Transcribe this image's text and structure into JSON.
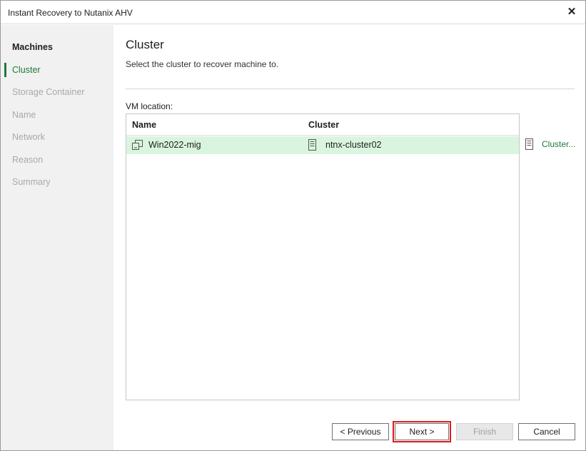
{
  "window": {
    "title": "Instant Recovery to Nutanix AHV",
    "close_glyph": "✕"
  },
  "sidebar": {
    "steps": [
      {
        "label": "Machines",
        "state": "done"
      },
      {
        "label": "Cluster",
        "state": "active"
      },
      {
        "label": "Storage Container",
        "state": "pending"
      },
      {
        "label": "Name",
        "state": "pending"
      },
      {
        "label": "Network",
        "state": "pending"
      },
      {
        "label": "Reason",
        "state": "pending"
      },
      {
        "label": "Summary",
        "state": "pending"
      }
    ]
  },
  "main": {
    "title": "Cluster",
    "subtitle": "Select the cluster to recover machine to.",
    "vm_location_label": "VM location:",
    "table": {
      "columns": [
        "Name",
        "Cluster"
      ],
      "rows": [
        {
          "name": "Win2022-mig",
          "name_icon": "vm-icon",
          "cluster": "ntnx-cluster02",
          "cluster_icon": "server-icon",
          "selected": true
        }
      ]
    },
    "cluster_button_label": "Cluster..."
  },
  "footer": {
    "previous_label": "< Previous",
    "next_label": "Next >",
    "finish_label": "Finish",
    "cancel_label": "Cancel"
  },
  "colors": {
    "accent_green": "#1e7a3c",
    "selected_row": "#daf5df",
    "highlight_red": "#e01b1b"
  }
}
